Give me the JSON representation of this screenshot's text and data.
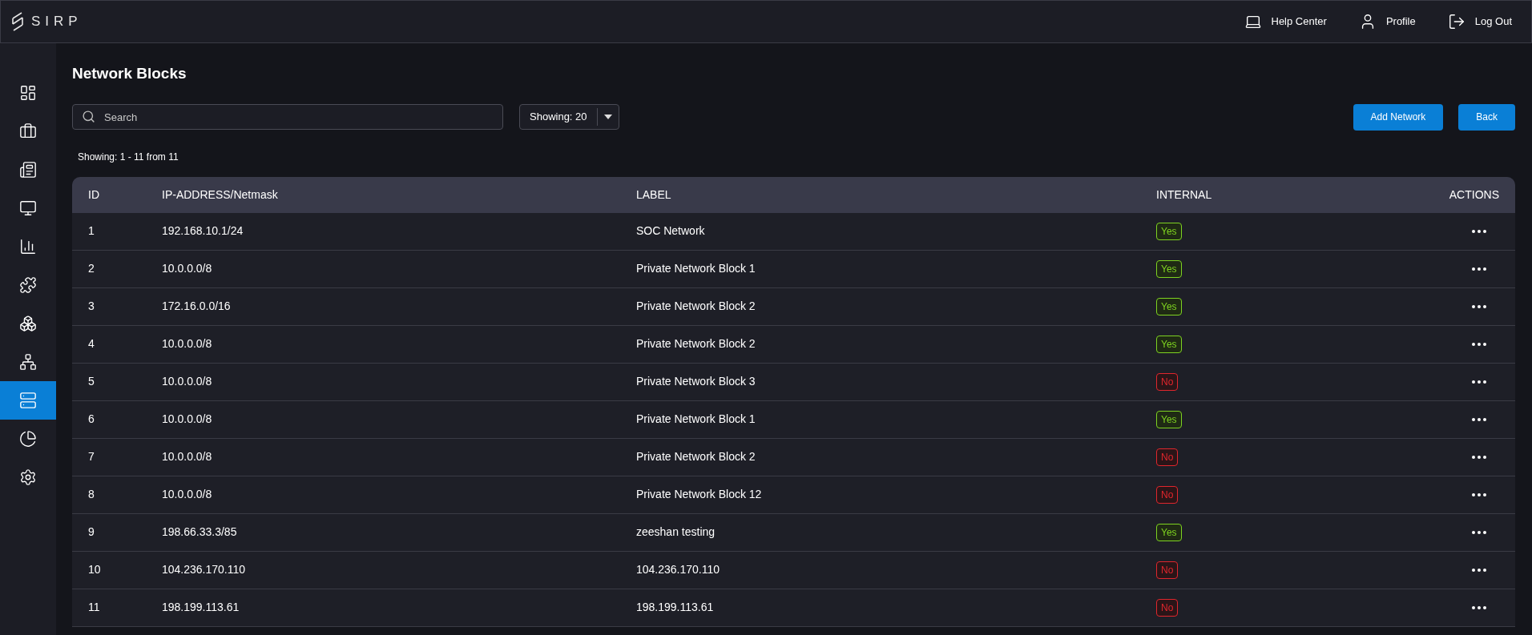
{
  "logo": {
    "text": "SIRP"
  },
  "header_links": [
    {
      "label": "Help Center"
    },
    {
      "label": "Profile"
    },
    {
      "label": "Log Out"
    }
  ],
  "sidebar": {
    "items": [
      {
        "selected": false
      },
      {
        "selected": false
      },
      {
        "selected": false
      },
      {
        "selected": false
      },
      {
        "selected": false
      },
      {
        "selected": false
      },
      {
        "selected": false
      },
      {
        "selected": false
      },
      {
        "selected": true
      },
      {
        "selected": false
      },
      {
        "selected": false
      }
    ]
  },
  "page_title": "Network Blocks",
  "search": {
    "placeholder": "Search"
  },
  "page_size": {
    "value": "Showing: 20"
  },
  "buttons": [
    "Add Network",
    "Back"
  ],
  "summary": "Showing: 1 - 11 from 11",
  "table": {
    "columns": [
      "ID",
      "IP-ADDRESS/Netmask",
      "LABEL",
      "INTERNAL",
      "ACTIONS"
    ],
    "rows": [
      {
        "id": "1",
        "ip": "192.168.10.1/24",
        "label": "SOC Network",
        "internal": {
          "text": "Yes",
          "on": true
        }
      },
      {
        "id": "2",
        "ip": "10.0.0.0/8",
        "label": "Private Network Block 1",
        "internal": {
          "text": "Yes",
          "on": true
        }
      },
      {
        "id": "3",
        "ip": "172.16.0.0/16",
        "label": "Private Network Block 2",
        "internal": {
          "text": "Yes",
          "on": true
        }
      },
      {
        "id": "4",
        "ip": "10.0.0.0/8",
        "label": "Private Network Block 2",
        "internal": {
          "text": "Yes",
          "on": true
        }
      },
      {
        "id": "5",
        "ip": "10.0.0.0/8",
        "label": "Private Network Block 3",
        "internal": {
          "text": "No",
          "on": false
        }
      },
      {
        "id": "6",
        "ip": "10.0.0.0/8",
        "label": "Private Network Block 1",
        "internal": {
          "text": "Yes",
          "on": true
        }
      },
      {
        "id": "7",
        "ip": "10.0.0.0/8",
        "label": "Private Network Block 2",
        "internal": {
          "text": "No",
          "on": false
        }
      },
      {
        "id": "8",
        "ip": "10.0.0.0/8",
        "label": "Private Network Block 12",
        "internal": {
          "text": "No",
          "on": false
        }
      },
      {
        "id": "9",
        "ip": "198.66.33.3/85",
        "label": "zeeshan testing",
        "internal": {
          "text": "Yes",
          "on": true
        }
      },
      {
        "id": "10",
        "ip": "104.236.170.110",
        "label": "104.236.170.110",
        "internal": {
          "text": "No",
          "on": false
        }
      },
      {
        "id": "11",
        "ip": "198.199.113.61",
        "label": "198.199.113.61",
        "internal": {
          "text": "No",
          "on": false
        }
      }
    ]
  }
}
